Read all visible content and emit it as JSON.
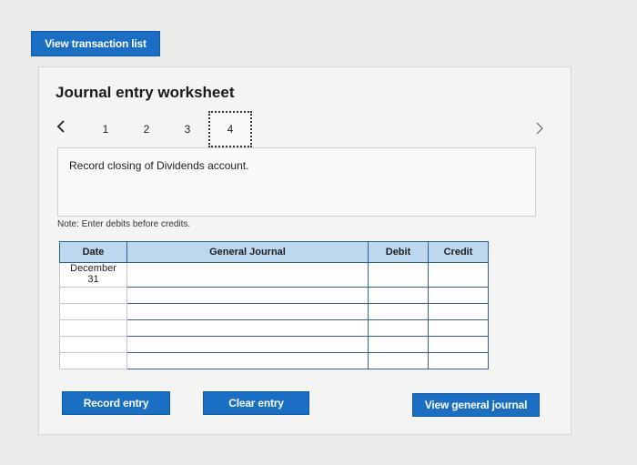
{
  "header": {
    "view_transaction_list": "View transaction list"
  },
  "worksheet": {
    "title": "Journal entry worksheet",
    "pages": [
      "1",
      "2",
      "3",
      "4"
    ],
    "active_page": "4",
    "instruction": "Record closing of Dividends account.",
    "note": "Note: Enter debits before credits."
  },
  "table": {
    "headers": {
      "date": "Date",
      "general_journal": "General Journal",
      "debit": "Debit",
      "credit": "Credit"
    },
    "rows": [
      {
        "date_month": "December",
        "date_day": "31"
      },
      {
        "date_month": "",
        "date_day": ""
      },
      {
        "date_month": "",
        "date_day": ""
      },
      {
        "date_month": "",
        "date_day": ""
      },
      {
        "date_month": "",
        "date_day": ""
      },
      {
        "date_month": "",
        "date_day": ""
      }
    ]
  },
  "buttons": {
    "record_entry": "Record entry",
    "clear_entry": "Clear entry",
    "view_general_journal": "View general journal"
  },
  "colors": {
    "button": "#1a6fc4",
    "header_bg": "#bdd7ef",
    "input_border": "#3a5f93"
  },
  "icons": {
    "prev": "chevron-left-icon",
    "next": "chevron-right-icon"
  }
}
